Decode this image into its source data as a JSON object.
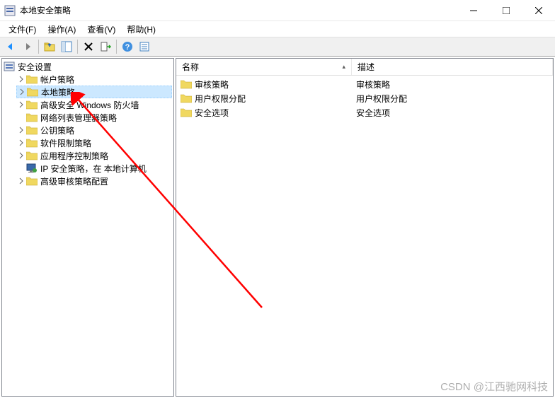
{
  "window": {
    "title": "本地安全策略"
  },
  "menubar": {
    "items": [
      {
        "label": "文件(F)"
      },
      {
        "label": "操作(A)"
      },
      {
        "label": "查看(V)"
      },
      {
        "label": "帮助(H)"
      }
    ]
  },
  "tree": {
    "root": {
      "label": "安全设置"
    },
    "items": [
      {
        "label": "帐户策略",
        "expandable": true
      },
      {
        "label": "本地策略",
        "expandable": true,
        "selected": true
      },
      {
        "label": "高级安全 Windows 防火墙",
        "expandable": true
      },
      {
        "label": "网络列表管理器策略",
        "expandable": false
      },
      {
        "label": "公钥策略",
        "expandable": true
      },
      {
        "label": "软件限制策略",
        "expandable": true
      },
      {
        "label": "应用程序控制策略",
        "expandable": true
      },
      {
        "label": "IP 安全策略，在 本地计算机",
        "expandable": false,
        "specialIcon": true
      },
      {
        "label": "高级审核策略配置",
        "expandable": true
      }
    ]
  },
  "list": {
    "columns": [
      {
        "label": "名称"
      },
      {
        "label": "描述"
      }
    ],
    "rows": [
      {
        "name": "审核策略",
        "desc": "审核策略"
      },
      {
        "name": "用户权限分配",
        "desc": "用户权限分配"
      },
      {
        "name": "安全选项",
        "desc": "安全选项"
      }
    ]
  },
  "watermark": "CSDN @江西驰网科技"
}
